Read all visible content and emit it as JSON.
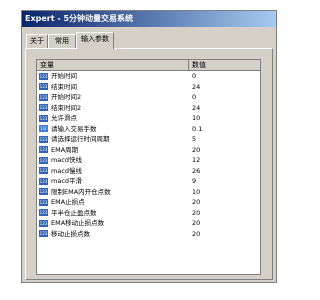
{
  "window": {
    "title": "Expert - 5分钟动量交易系统"
  },
  "tabs": [
    {
      "label": "关于"
    },
    {
      "label": "常用"
    },
    {
      "label": "输入参数"
    }
  ],
  "table": {
    "headers": [
      "变量",
      "数值"
    ],
    "rows": [
      {
        "icon": "123",
        "name": "开始时间",
        "value": "0"
      },
      {
        "icon": "123",
        "name": "结束时间",
        "value": "24"
      },
      {
        "icon": "123",
        "name": "开始时间2",
        "value": "0"
      },
      {
        "icon": "123",
        "name": "结束时间2",
        "value": "24"
      },
      {
        "icon": "123",
        "name": "允许滑点",
        "value": "10"
      },
      {
        "icon": "1/2",
        "name": "请输入交易手数",
        "value": "0.1"
      },
      {
        "icon": "123",
        "name": "请选择运行时间周期",
        "value": "5"
      },
      {
        "icon": "123",
        "name": "EMA周期",
        "value": "20"
      },
      {
        "icon": "123",
        "name": "macd快线",
        "value": "12"
      },
      {
        "icon": "123",
        "name": "macd慢线",
        "value": "26"
      },
      {
        "icon": "123",
        "name": "macd平滑",
        "value": "9"
      },
      {
        "icon": "123",
        "name": "限制EMA内开仓点数",
        "value": "10"
      },
      {
        "icon": "123",
        "name": "EMA止损点",
        "value": "20"
      },
      {
        "icon": "123",
        "name": "平半仓止盈点数",
        "value": "20"
      },
      {
        "icon": "123",
        "name": "EMA移动止损点数",
        "value": "20"
      },
      {
        "icon": "123",
        "name": "移动止损点数",
        "value": "20"
      }
    ]
  }
}
